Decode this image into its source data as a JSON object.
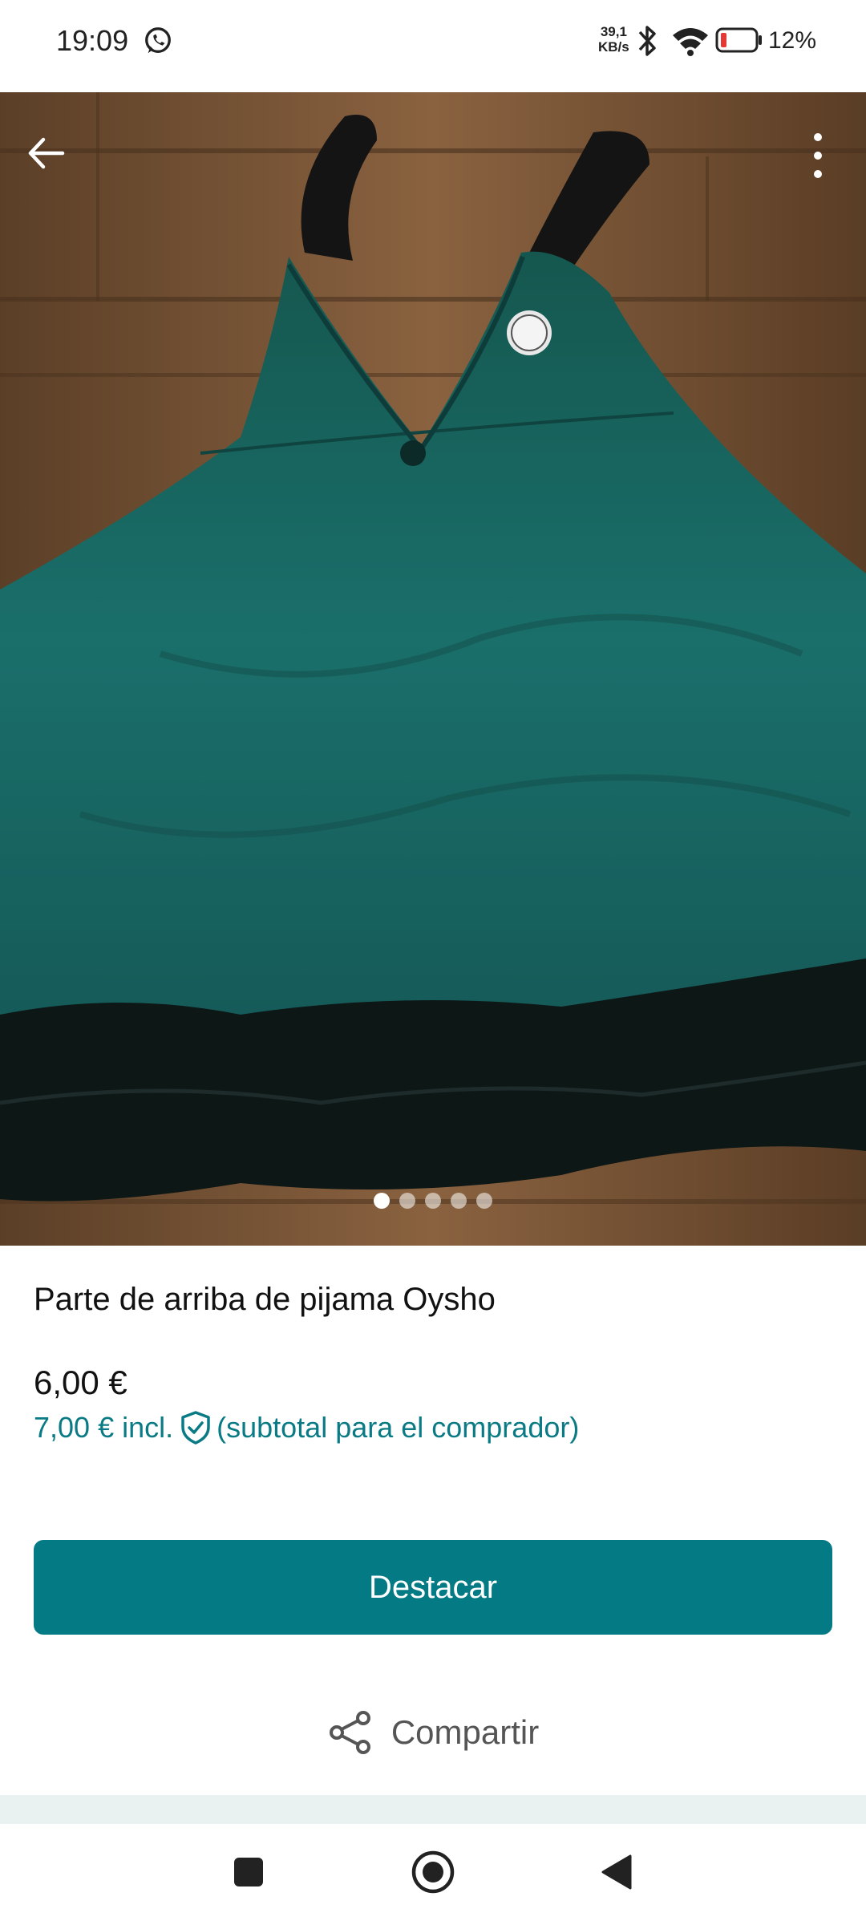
{
  "status_bar": {
    "time": "19:09",
    "net_speed_value": "39,1",
    "net_speed_unit": "KB/s",
    "battery_percent": "12%",
    "icons": [
      "whatsapp-icon",
      "bluetooth-icon",
      "wifi-icon",
      "battery-low-icon"
    ]
  },
  "gallery": {
    "image_count": 5,
    "active_index": 0
  },
  "product": {
    "title": "Parte de arriba de pijama Oysho",
    "price": "6,00 €",
    "buyer_price": "7,00 €",
    "buyer_incl": "incl.",
    "buyer_note": "(subtotal para el comprador)"
  },
  "actions": {
    "primary_label": "Destacar",
    "share_label": "Compartir"
  },
  "colors": {
    "accent": "#047a85",
    "accent_text": "#0a7a85",
    "battery_low": "#e53935"
  }
}
